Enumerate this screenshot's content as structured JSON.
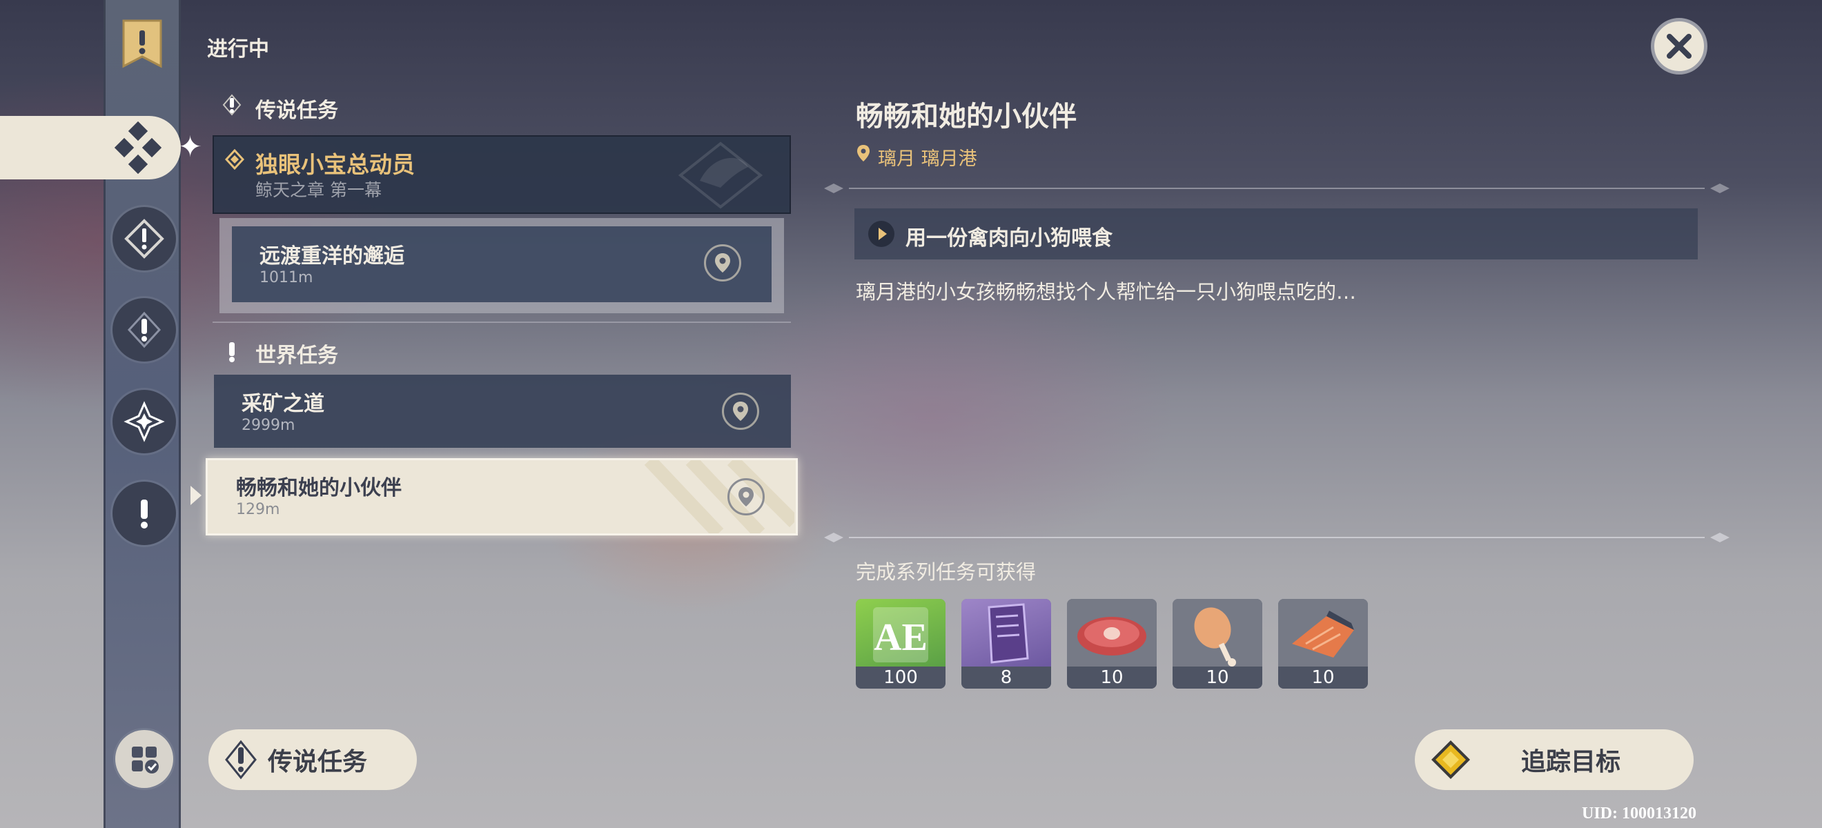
{
  "header": {
    "section_label": "进行中"
  },
  "quest_list": {
    "legend_section": "传说任务",
    "legend_chapter": {
      "title": "独眼小宝总动员",
      "subtitle": "鲸天之章 第一幕"
    },
    "legend_quest": {
      "title": "远渡重洋的邂逅",
      "distance": "1011m"
    },
    "world_section": "世界任务",
    "world_quests": [
      {
        "title": "采矿之道",
        "distance": "2999m"
      },
      {
        "title": "畅畅和她的小伙伴",
        "distance": "129m"
      }
    ]
  },
  "detail": {
    "title": "畅畅和她的小伙伴",
    "location": "璃月 璃月港",
    "objective": "用一份禽肉向小狗喂食",
    "description": "璃月港的小女孩畅畅想找个人帮忙给一只小狗喂点吃的…",
    "rewards_label": "完成系列任务可获得",
    "rewards": [
      {
        "icon": "adventure-exp-icon",
        "count": "100"
      },
      {
        "icon": "purple-book-icon",
        "count": "8"
      },
      {
        "icon": "raw-meat-icon",
        "count": "10"
      },
      {
        "icon": "fowl-icon",
        "count": "10"
      },
      {
        "icon": "fish-icon",
        "count": "10"
      }
    ]
  },
  "footer": {
    "legend_button": "传说任务",
    "track_button": "追踪目标",
    "uid": "UID: 100013120"
  },
  "colors": {
    "gold": "#e9c27a",
    "cream": "#ece6d8",
    "panel": "#343e54"
  }
}
